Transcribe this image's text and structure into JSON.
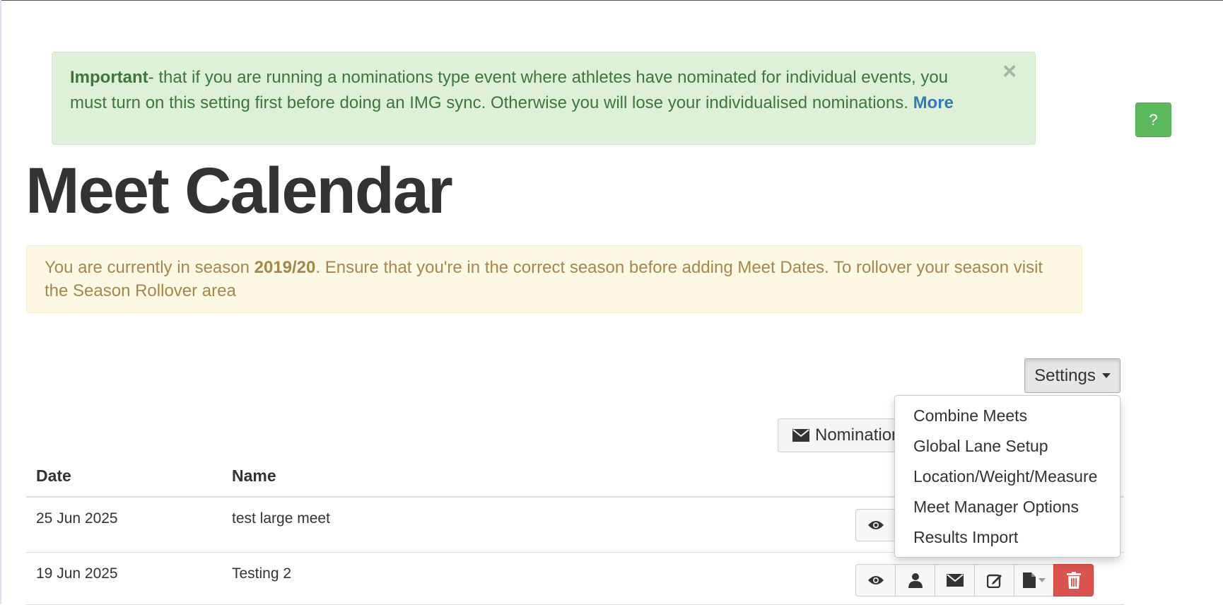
{
  "alert_success": {
    "strong": "Important",
    "text": "- that if you are running a nominations type event where athletes have nominated for individual events, you must turn on this setting first before doing an IMG sync. Otherwise you will lose your individualised nominations. ",
    "link": "More",
    "close": "×"
  },
  "help_button": "?",
  "page_title": "Meet Calendar",
  "alert_warning": {
    "prefix": "You are currently in season ",
    "season": "2019/20",
    "suffix": ". Ensure that you're in the correct season before adding Meet Dates. To rollover your season visit the Season Rollover area"
  },
  "settings": {
    "label": "Settings",
    "menu": [
      "Combine Meets",
      "Global Lane Setup",
      "Location/Weight/Measure",
      "Meet Manager Options",
      "Results Import"
    ]
  },
  "nominations_button": "Nominations",
  "table": {
    "headers": {
      "date": "Date",
      "name": "Name"
    },
    "rows": [
      {
        "date": "25 Jun 2025",
        "name": "test large meet"
      },
      {
        "date": "19 Jun 2025",
        "name": "Testing 2"
      }
    ]
  },
  "icons": [
    "eye-icon",
    "user-icon",
    "envelope-icon",
    "edit-icon",
    "file-dropdown-icon",
    "trash-icon"
  ],
  "colors": {
    "success_bg": "#dff0d8",
    "warning_bg": "#fcf8e3",
    "help_green": "#5cb85c",
    "danger_red": "#d9534f",
    "link_blue": "#337ab7"
  }
}
